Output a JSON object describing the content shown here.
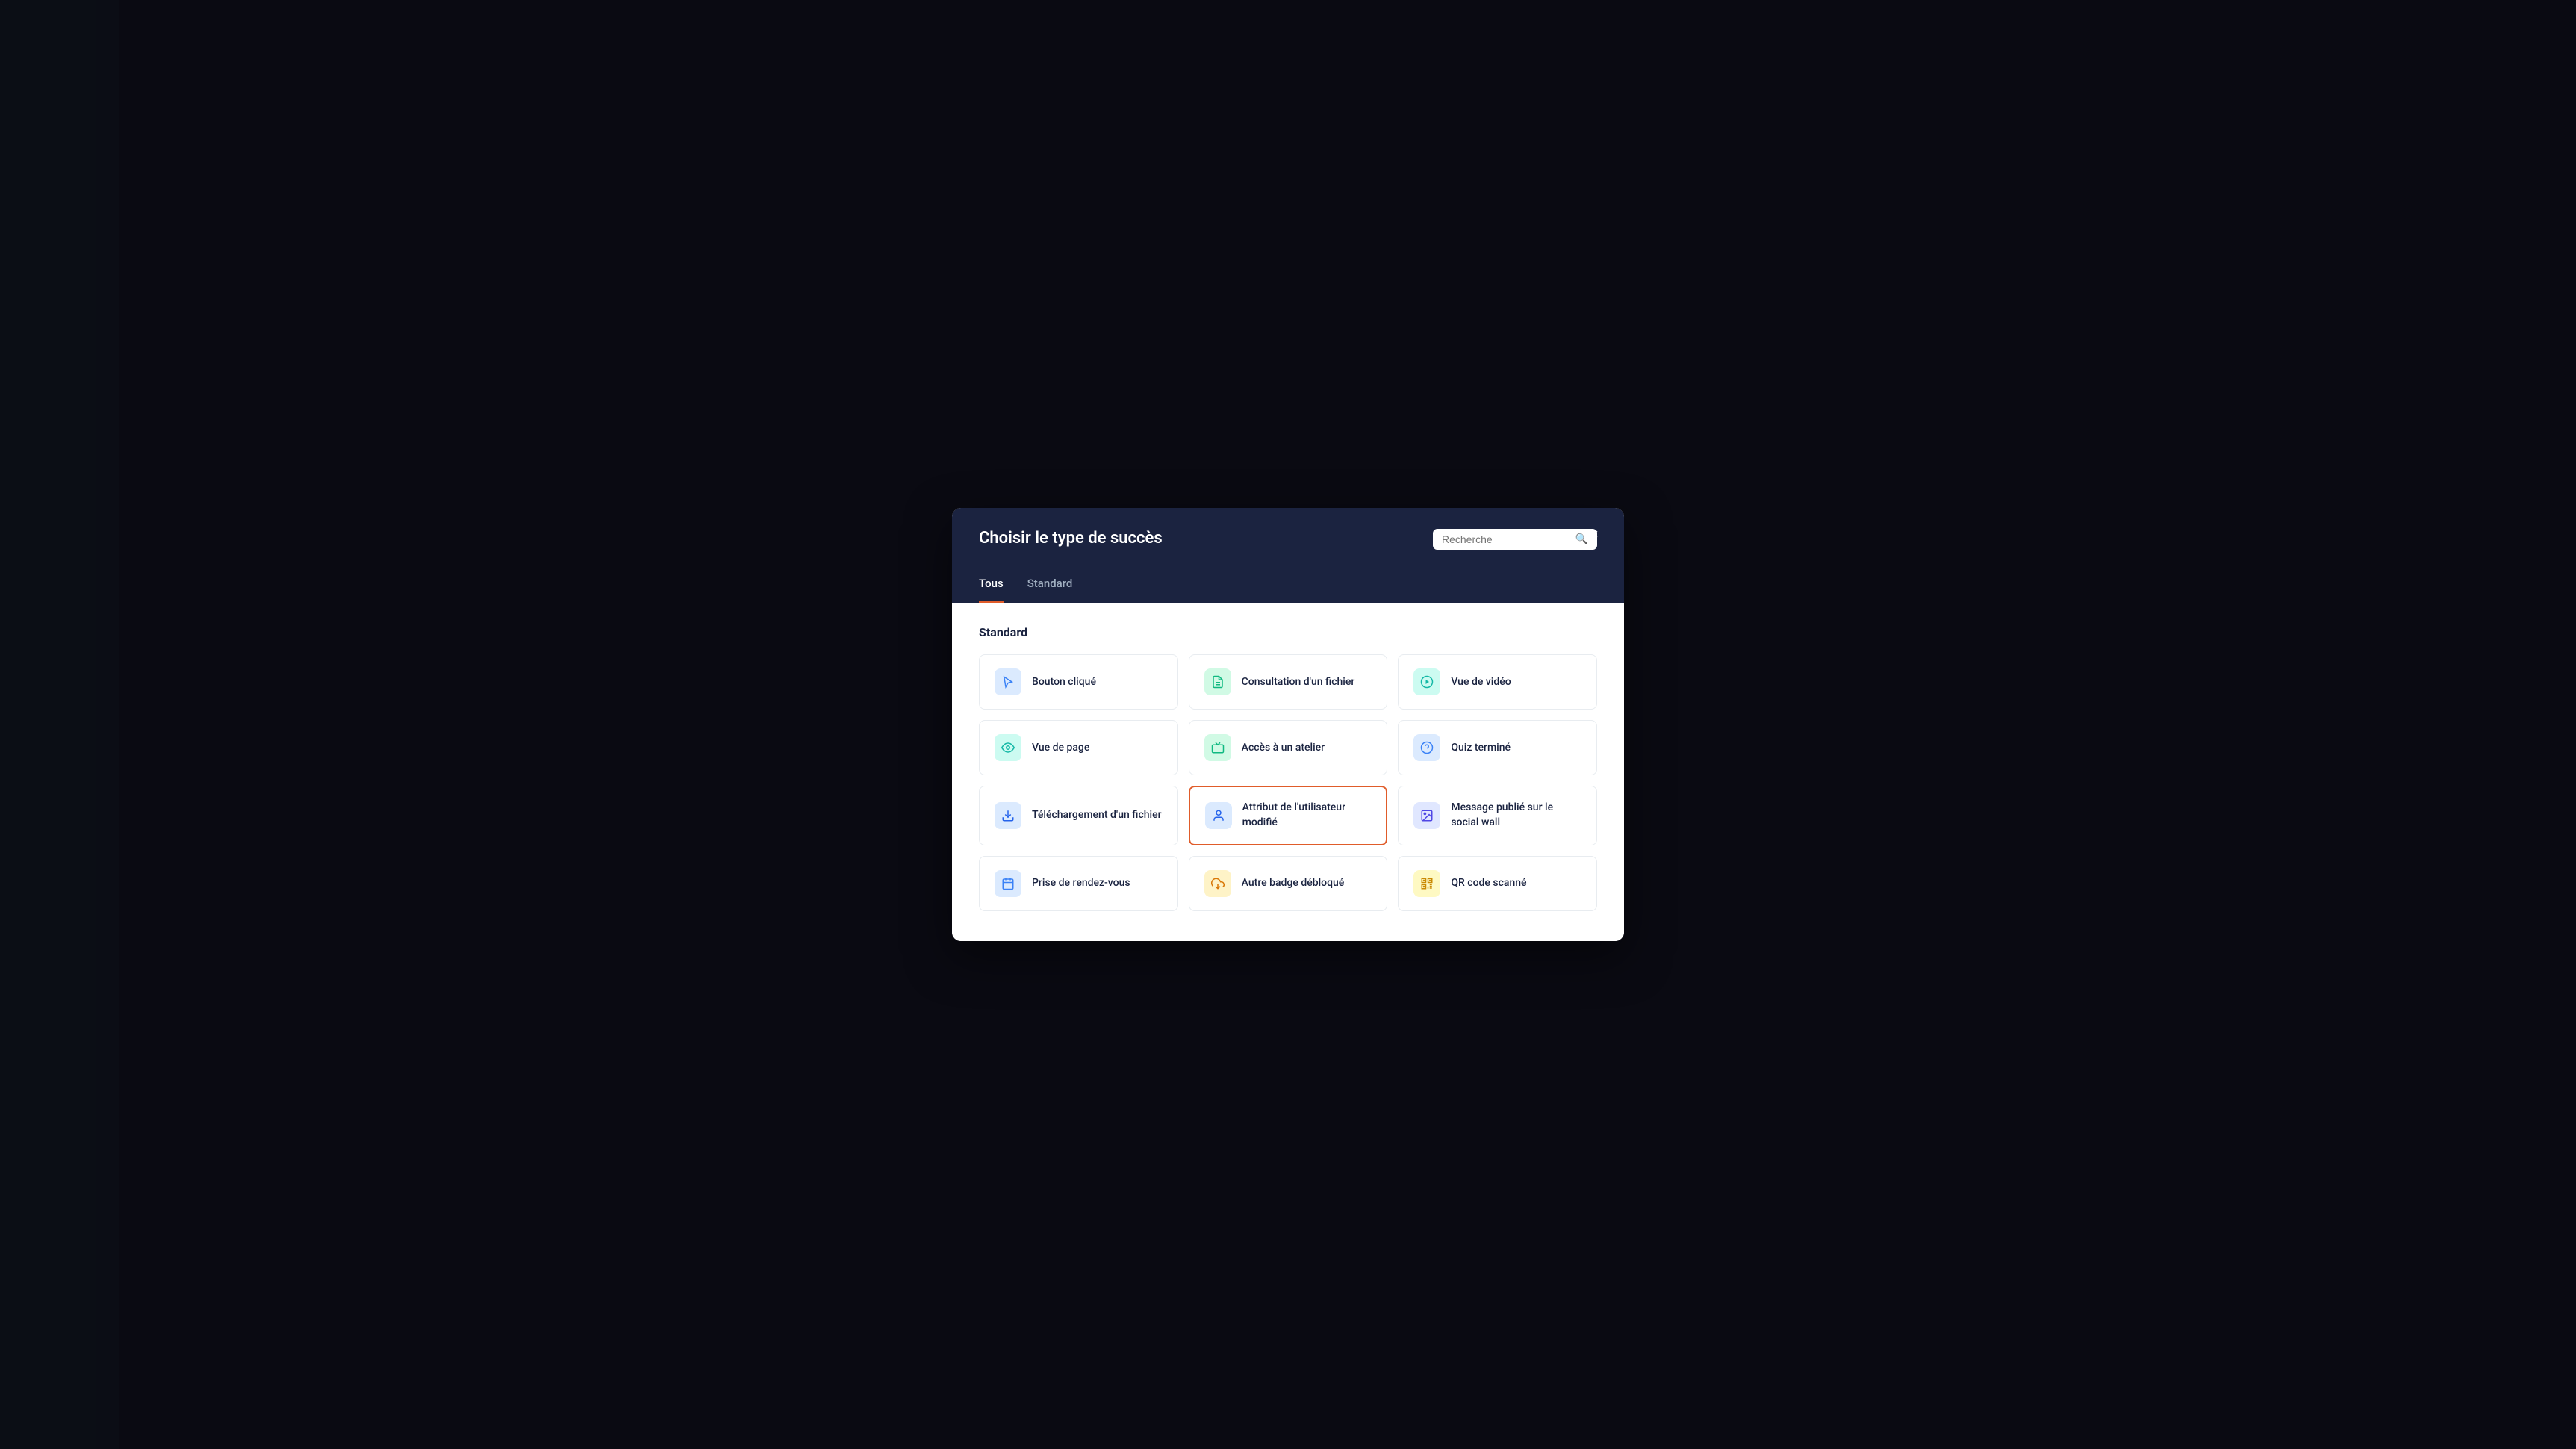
{
  "modal": {
    "title": "Choisir le type de succès",
    "close_label": "×",
    "search": {
      "placeholder": "Recherche"
    },
    "tabs": [
      {
        "id": "tous",
        "label": "Tous",
        "active": true
      },
      {
        "id": "standard",
        "label": "Standard",
        "active": false
      }
    ],
    "sections": [
      {
        "id": "standard-section",
        "title": "Standard",
        "cards": [
          {
            "id": "bouton-clique",
            "label": "Bouton cliqué",
            "icon": "cursor",
            "icon_class": "blue-light",
            "selected": false
          },
          {
            "id": "consultation-fichier",
            "label": "Consultation d'un fichier",
            "icon": "doc",
            "icon_class": "green-light",
            "selected": false
          },
          {
            "id": "vue-video",
            "label": "Vue de vidéo",
            "icon": "play",
            "icon_class": "teal-light",
            "selected": false
          },
          {
            "id": "vue-page",
            "label": "Vue de page",
            "icon": "eye",
            "icon_class": "teal-light",
            "selected": false
          },
          {
            "id": "acces-atelier",
            "label": "Accès à un atelier",
            "icon": "camera",
            "icon_class": "green-light",
            "selected": false
          },
          {
            "id": "quiz-termine",
            "label": "Quiz terminé",
            "icon": "question",
            "icon_class": "blue-light",
            "selected": false
          },
          {
            "id": "telechargement-fichier",
            "label": "Téléchargement d'un fichier",
            "icon": "download",
            "icon_class": "blue2-light",
            "selected": false
          },
          {
            "id": "attribut-utilisateur",
            "label": "Attribut de l'utilisateur modifié",
            "icon": "user",
            "icon_class": "blue2-light",
            "selected": true
          },
          {
            "id": "message-social",
            "label": "Message publié sur le social wall",
            "icon": "image",
            "icon_class": "indigo-light",
            "selected": false
          },
          {
            "id": "prise-rendez-vous",
            "label": "Prise de rendez-vous",
            "icon": "calendar",
            "icon_class": "blue-light",
            "selected": false
          },
          {
            "id": "autre-badge",
            "label": "Autre badge débloqué",
            "icon": "trophy",
            "icon_class": "amber-light",
            "selected": false
          },
          {
            "id": "qr-code",
            "label": "QR code scanné",
            "icon": "qr",
            "icon_class": "yellow-light",
            "selected": false
          }
        ]
      }
    ]
  }
}
